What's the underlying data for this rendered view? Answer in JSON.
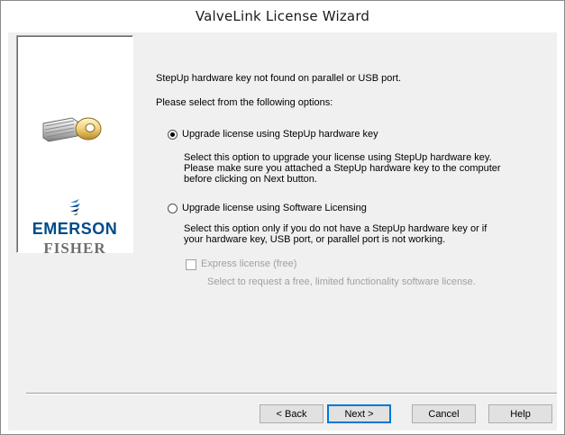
{
  "window": {
    "title": "ValveLink License Wizard"
  },
  "logo_panel": {
    "icons": [
      "key-icon",
      "emerson-logo-icon"
    ],
    "brand_primary": "EMERSON",
    "brand_secondary": "FISHER",
    "brand_primary_color": "#004b87",
    "brand_secondary_color": "#6d6e71"
  },
  "content": {
    "status_message": "StepUp hardware key not found on parallel or USB port.",
    "prompt": "Please select from the following options:",
    "options": [
      {
        "label": "Upgrade license using StepUp hardware key",
        "selected": true,
        "description_lines": [
          "Select this option to upgrade your license using StepUp hardware key.",
          "Please make sure you attached a StepUp hardware key to the computer",
          "before clicking on Next button."
        ]
      },
      {
        "label": "Upgrade license using Software Licensing",
        "selected": false,
        "description_lines": [
          "Select this option only if you do not have a StepUp hardware key or if",
          "your hardware key, USB port, or parallel port is not working."
        ]
      }
    ],
    "express": {
      "label": "Express license (free)",
      "checked": false,
      "enabled": false,
      "description": "Select to request a free, limited functionality software license."
    }
  },
  "buttons": {
    "back": "< Back",
    "next": "Next >",
    "cancel": "Cancel",
    "help": "Help"
  }
}
